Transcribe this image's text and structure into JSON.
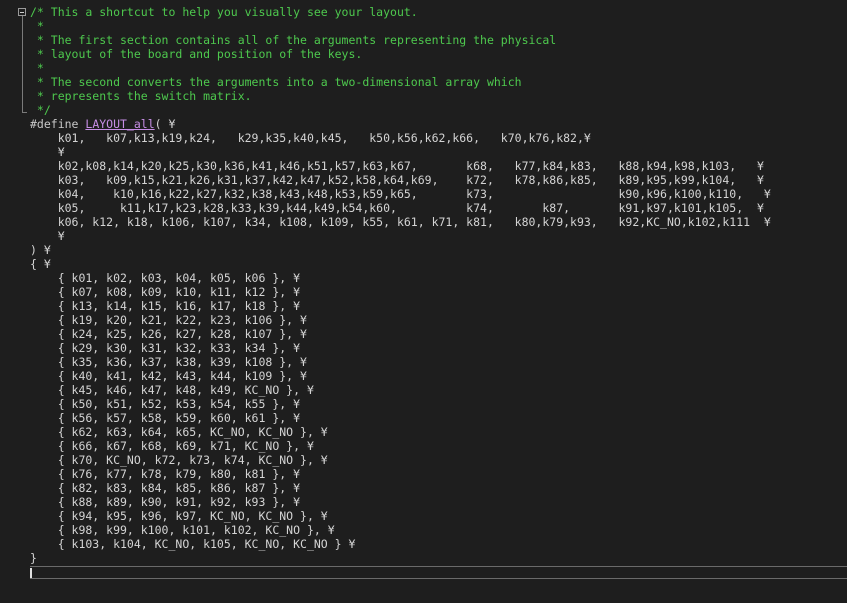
{
  "editor": {
    "lines": [
      "/* This a shortcut to help you visually see your layout.",
      " *",
      " * The first section contains all of the arguments representing the physical",
      " * layout of the board and position of the keys.",
      " *",
      " * The second converts the arguments into a two-dimensional array which",
      " * represents the switch matrix.",
      " */",
      "#define ",
      "    k01,   k07,k13,k19,k24,   k29,k35,k40,k45,   k50,k56,k62,k66,   k70,k76,k82,¥",
      "    ¥",
      "    k02,k08,k14,k20,k25,k30,k36,k41,k46,k51,k57,k63,k67,       k68,   k77,k84,k83,   k88,k94,k98,k103,   ¥",
      "    k03,   k09,k15,k21,k26,k31,k37,k42,k47,k52,k58,k64,k69,    k72,   k78,k86,k85,   k89,k95,k99,k104,   ¥",
      "    k04,    k10,k16,k22,k27,k32,k38,k43,k48,k53,k59,k65,       k73,                  k90,k96,k100,k110,   ¥",
      "    k05,     k11,k17,k23,k28,k33,k39,k44,k49,k54,k60,          k74,       k87,       k91,k97,k101,k105,  ¥",
      "    k06, k12, k18, k106, k107, k34, k108, k109, k55, k61, k71, k81,   k80,k79,k93,   k92,KC_NO,k102,k111  ¥",
      "    ¥",
      ") ¥",
      "{ ¥",
      "    { k01, k02, k03, k04, k05, k06 }, ¥",
      "    { k07, k08, k09, k10, k11, k12 }, ¥",
      "    { k13, k14, k15, k16, k17, k18 }, ¥",
      "    { k19, k20, k21, k22, k23, k106 }, ¥",
      "    { k24, k25, k26, k27, k28, k107 }, ¥",
      "    { k29, k30, k31, k32, k33, k34 }, ¥",
      "    { k35, k36, k37, k38, k39, k108 }, ¥",
      "    { k40, k41, k42, k43, k44, k109 }, ¥",
      "    { k45, k46, k47, k48, k49, KC_NO }, ¥",
      "    { k50, k51, k52, k53, k54, k55 }, ¥",
      "    { k56, k57, k58, k59, k60, k61 }, ¥",
      "    { k62, k63, k64, k65, KC_NO, KC_NO }, ¥",
      "    { k66, k67, k68, k69, k71, KC_NO }, ¥",
      "    { k70, KC_NO, k72, k73, k74, KC_NO }, ¥",
      "    { k76, k77, k78, k79, k80, k81 }, ¥",
      "    { k82, k83, k84, k85, k86, k87 }, ¥",
      "    { k88, k89, k90, k91, k92, k93 }, ¥",
      "    { k94, k95, k96, k97, KC_NO, KC_NO }, ¥",
      "    { k98, k99, k100, k101, k102, KC_NO }, ¥",
      "    { k103, k104, KC_NO, k105, KC_NO, KC_NO } ¥",
      "}"
    ],
    "define_macro": "LAYOUT_all",
    "define_tail": "( ¥"
  },
  "colors": {
    "background": "#1e1e1e",
    "comment": "#4ec94e",
    "macro": "#c78ee6",
    "text": "#d4d4d4"
  }
}
